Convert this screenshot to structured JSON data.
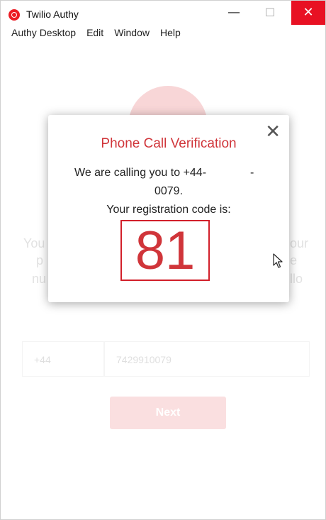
{
  "window": {
    "title": "Twilio Authy",
    "minimize_glyph": "—",
    "maximize_glyph": "☐",
    "close_glyph": "✕"
  },
  "menu": [
    "Authy Desktop",
    "Edit",
    "Window",
    "Help"
  ],
  "background": {
    "left_fragments": [
      "You",
      "p",
      "nu"
    ],
    "right_fragments": [
      "our",
      "e",
      "llo"
    ],
    "country_code": "+44",
    "phone_number": "7429910079",
    "next_label": "Next"
  },
  "dialog": {
    "title": "Phone Call Verification",
    "calling_prefix": "We are calling you to +44-",
    "calling_suffix": "-",
    "number_tail": "0079.",
    "code_label": "Your registration code is:",
    "code": "81",
    "close_glyph": "✕"
  },
  "colors": {
    "accent_red": "#d0353a",
    "close_button_bg": "#e81123"
  }
}
